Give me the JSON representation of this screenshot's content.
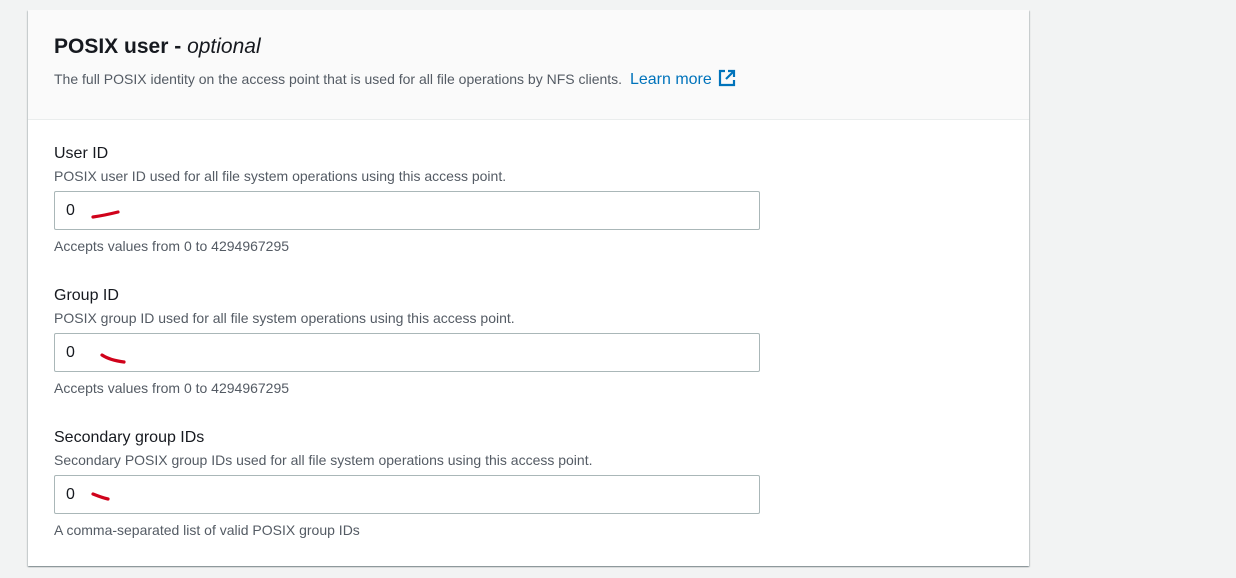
{
  "section": {
    "title_main": "POSIX user",
    "title_dash": " - ",
    "title_optional": "optional",
    "description": "The full POSIX identity on the access point that is used for all file operations by NFS clients.",
    "learn_more": "Learn more",
    "learn_more_icon": "external-link-icon"
  },
  "fields": {
    "user_id": {
      "label": "User ID",
      "help": "POSIX user ID used for all file system operations using this access point.",
      "value": "0",
      "constraint": "Accepts values from 0 to 4294967295"
    },
    "group_id": {
      "label": "Group ID",
      "help": "POSIX group ID used for all file system operations using this access point.",
      "value": "0",
      "constraint": "Accepts values from 0 to 4294967295"
    },
    "secondary_group_ids": {
      "label": "Secondary group IDs",
      "help": "Secondary POSIX group IDs used for all file system operations using this access point.",
      "value": "0",
      "constraint": "A comma-separated list of valid POSIX group IDs"
    }
  },
  "colors": {
    "link": "#0073bb",
    "annotation": "#d0021b"
  }
}
